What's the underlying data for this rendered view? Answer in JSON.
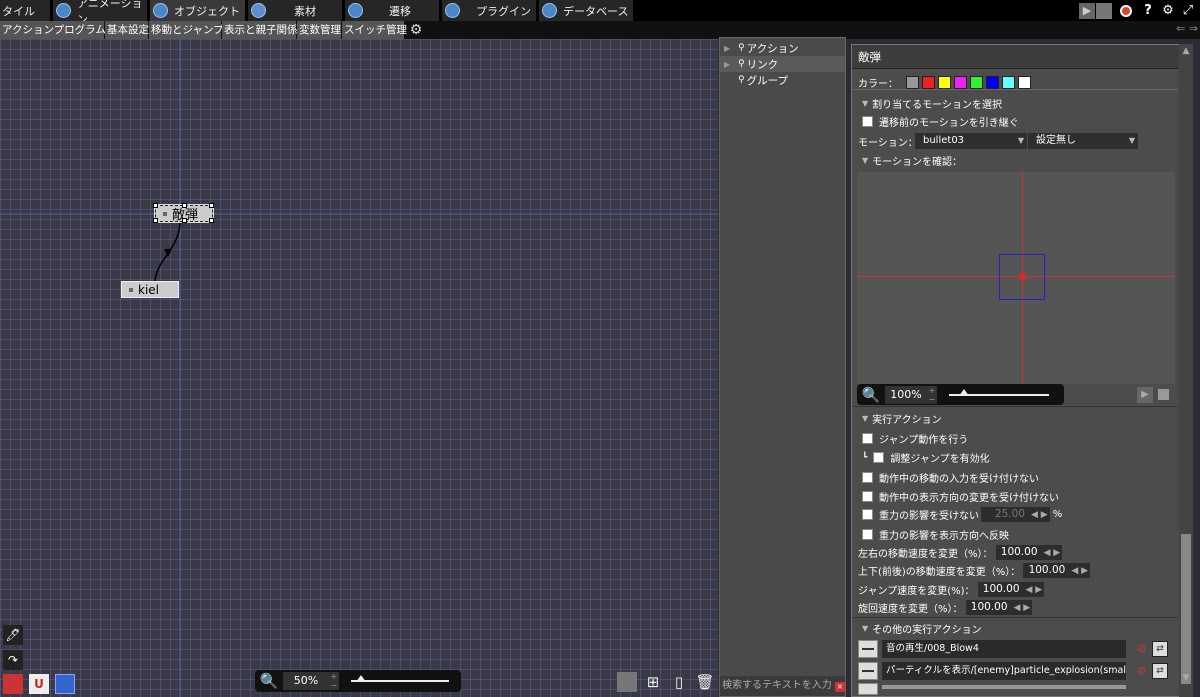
{
  "top_tabs": [
    {
      "label": "タイル"
    },
    {
      "label": "アニメーション"
    },
    {
      "label": "オブジェクト"
    },
    {
      "label": "素材"
    },
    {
      "label": "遷移"
    },
    {
      "label": "プラグイン"
    },
    {
      "label": "データベース"
    }
  ],
  "sub_tabs": [
    "アクションプログラム",
    "基本設定",
    "移動とジャンプ",
    "表示と親子関係",
    "変数管理",
    "スイッチ管理"
  ],
  "nodes": {
    "enemy": "敵弾",
    "kiel": "kiel"
  },
  "canvas_zoom": "50%",
  "tree": {
    "items": [
      "アクション",
      "リンク",
      "グループ"
    ],
    "search_placeholder": "検索するテキストを入力"
  },
  "panel": {
    "title": "敵弾",
    "color_label": "カラー：",
    "colors": [
      "#999999",
      "#ee2222",
      "#ffff00",
      "#ee22ee",
      "#33ee33",
      "#0000ee",
      "#66ffff",
      "#ffffff"
    ],
    "motion_section": "割り当てるモーションを選択",
    "inherit_motion": "遷移前のモーションを引き継ぐ",
    "motion_label": "モーション：",
    "motion_value": "bullet03",
    "motion_setting": "設定無し",
    "check_motion": "モーションを確認：",
    "preview_zoom": "100%",
    "exec_section": "実行アクション",
    "jump": "ジャンプ動作を行う",
    "adjust_jump": "調整ジャンプを有効化",
    "no_move_input": "動作中の移動の入力を受け付けない",
    "no_dir_change": "動作中の表示方向の変更を受け付けない",
    "no_gravity": "重力の影響を受けない",
    "gravity_value": "25.00",
    "percent": "%",
    "gravity_reverse": "重力の影響を表示方向へ反映",
    "lr_speed_label": "左右の移動速度を変更（%）：",
    "lr_speed": "100.00",
    "ud_speed_label": "上下(前後)の移動速度を変更（%）：",
    "ud_speed": "100.00",
    "jump_speed_label": "ジャンプ速度を変更(%)：",
    "jump_speed": "100.00",
    "rot_speed_label": "旋回速度を変更（%）：",
    "rot_speed": "100.00",
    "other_section": "その他の実行アクション",
    "other_actions": [
      "音の再生/008_Blow4",
      "パーティクルを表示/[enemy]particle_explosion(small)"
    ]
  }
}
